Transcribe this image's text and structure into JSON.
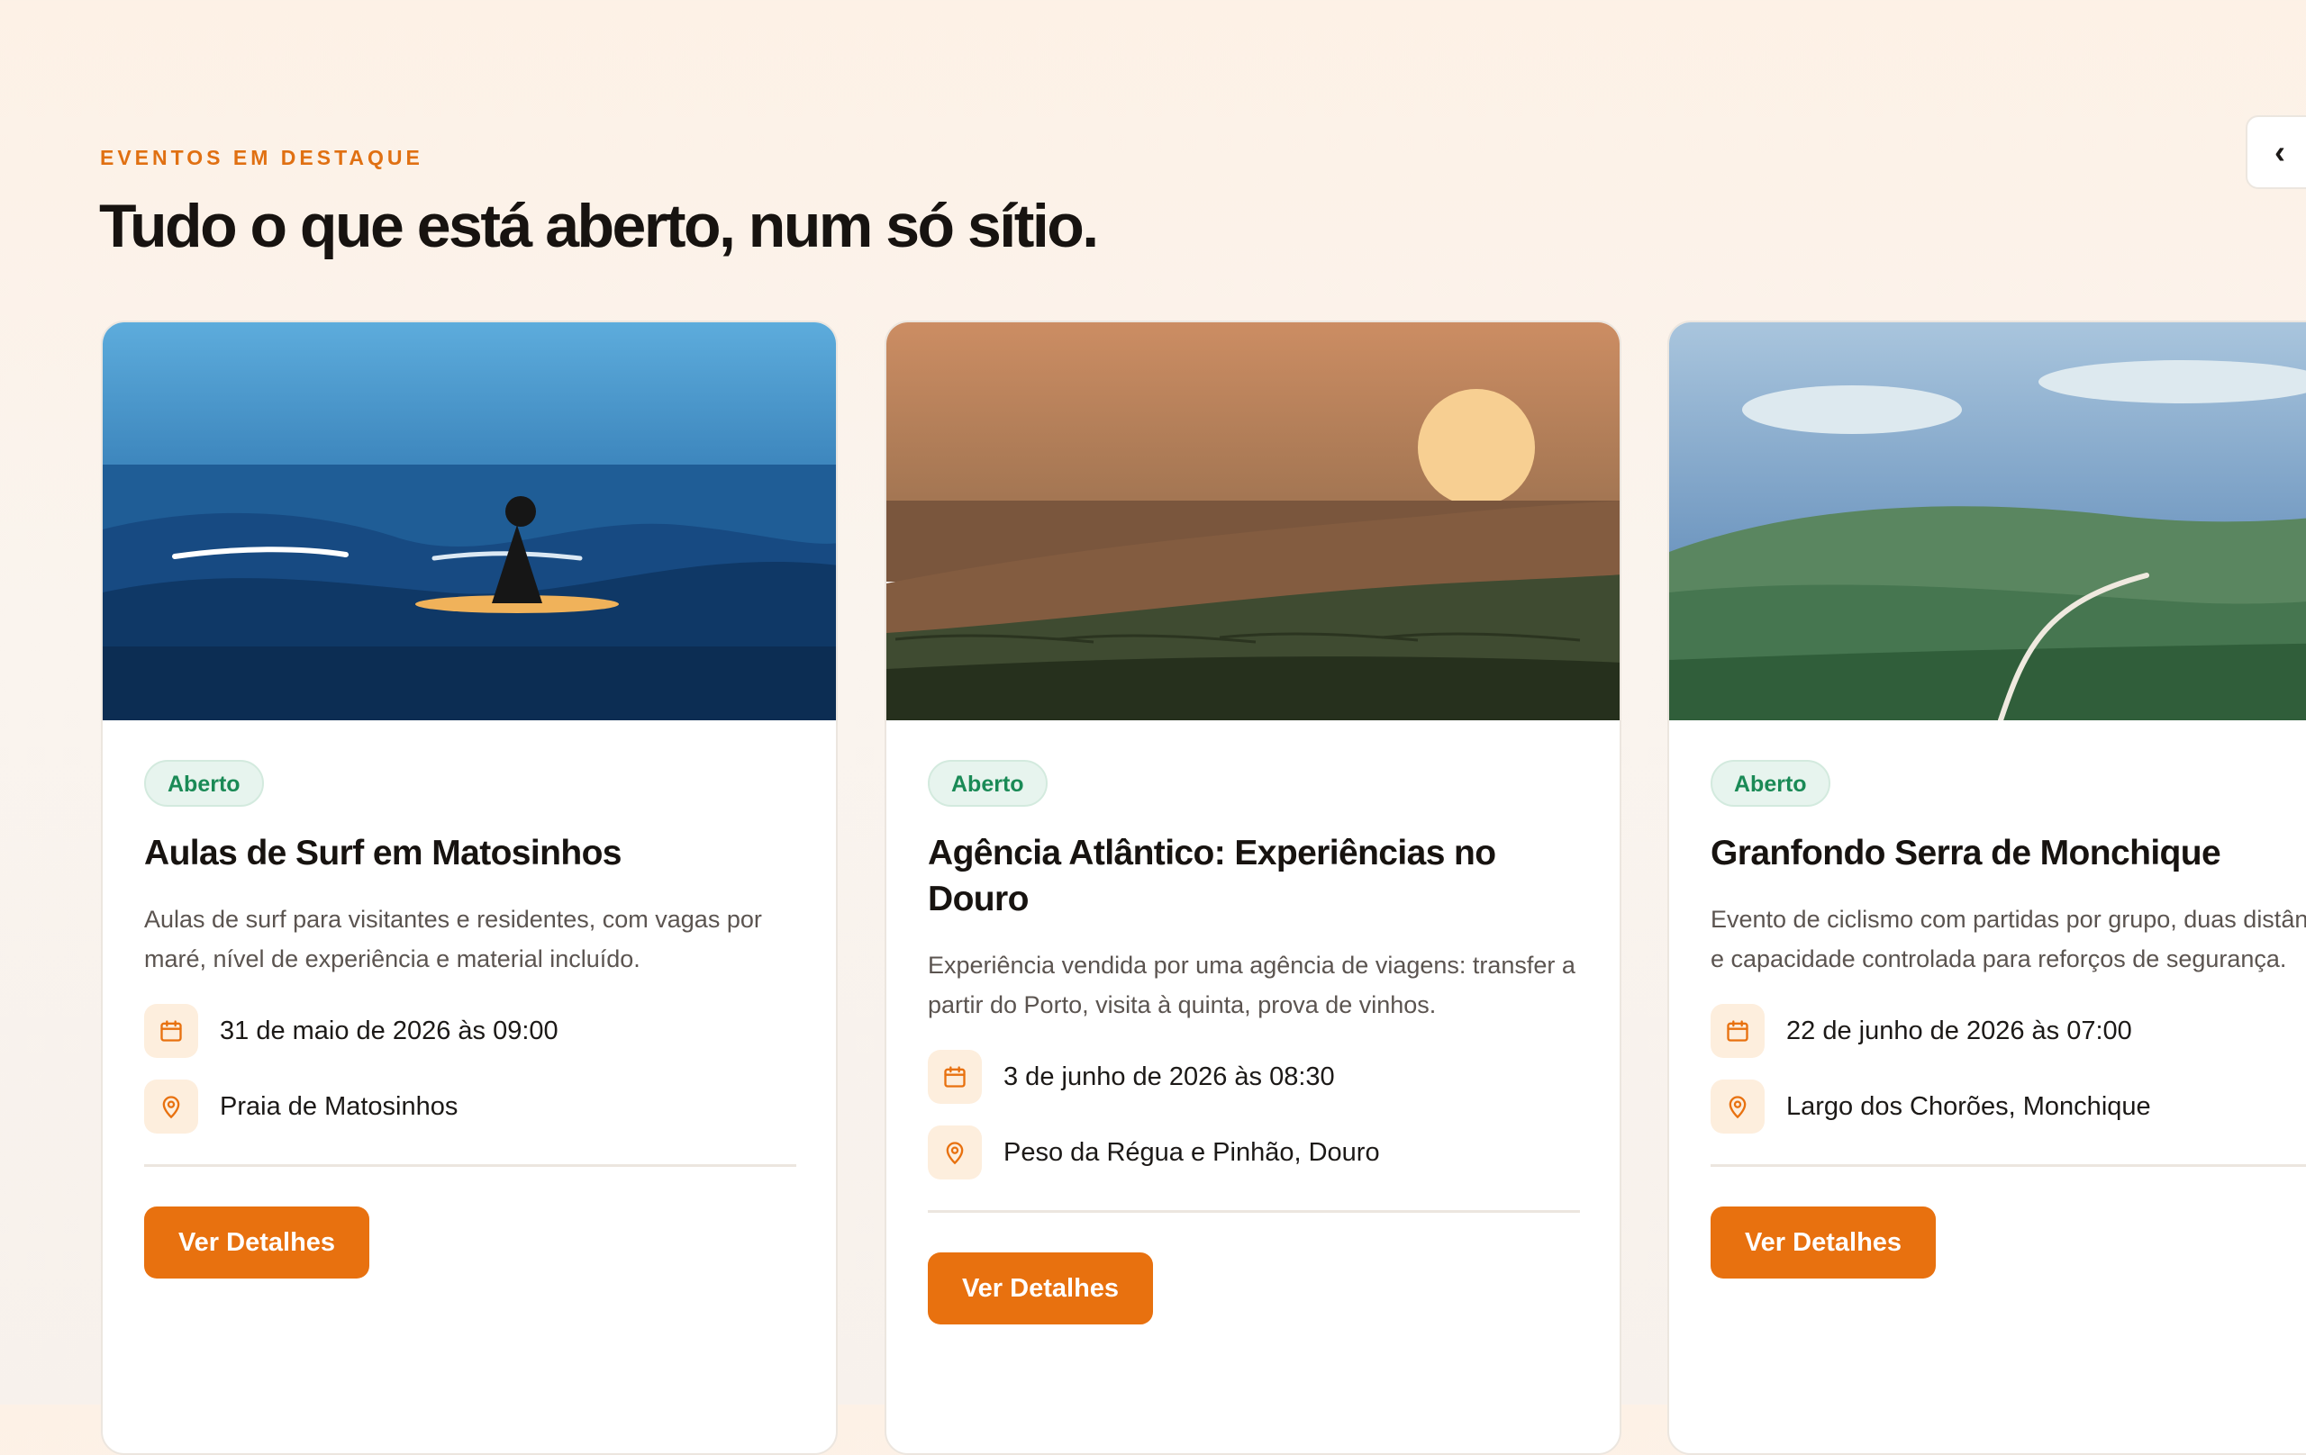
{
  "section": {
    "eyebrow": "EVENTOS EM DESTAQUE",
    "heading": "Tudo o que está aberto, num só sítio.",
    "nav_prev": "‹"
  },
  "colors": {
    "accent": "#e8710f",
    "badge_text": "#1a8a56",
    "badge_bg": "#e7f4ee",
    "icon_bg": "#fdeedd"
  },
  "cards": [
    {
      "image_icon": "surfer-illustration",
      "status": "Aberto",
      "title": "Aulas de Surf em Matosinhos",
      "description": "Aulas de surf para visitantes e residentes, com vagas por maré, nível de experiência e material incluído.",
      "date": "31 de maio de 2026 às 09:00",
      "location": "Praia de Matosinhos",
      "cta": "Ver Detalhes"
    },
    {
      "image_icon": "douro-sunset-illustration",
      "status": "Aberto",
      "title": "Agência Atlântico: Experiências no Douro",
      "description": "Experiência vendida por uma agência de viagens: transfer a partir do Porto, visita à quinta, prova de vinhos.",
      "date": "3 de junho de 2026 às 08:30",
      "location": "Peso da Régua e Pinhão, Douro",
      "cta": "Ver Detalhes"
    },
    {
      "image_icon": "mountain-road-illustration",
      "status": "Aberto",
      "title": "Granfondo Serra de Monchique",
      "description": "Evento de ciclismo com partidas por grupo, duas distâncias e capacidade controlada para reforços de segurança.",
      "date": "22 de junho de 2026 às 07:00",
      "location": "Largo dos Chorões, Monchique",
      "cta": "Ver Detalhes"
    }
  ]
}
